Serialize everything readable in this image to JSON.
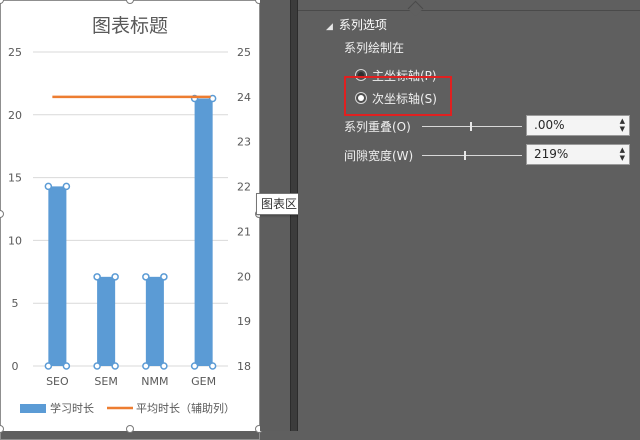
{
  "chart_data": {
    "type": "bar",
    "title": "图表标题",
    "categories": [
      "SEO",
      "SEM",
      "NMM",
      "GEM"
    ],
    "series": [
      {
        "name": "学习时长",
        "kind": "bar",
        "axis": "primary",
        "color": "#5b9bd5",
        "values": [
          14.3,
          7.1,
          7.1,
          21.3
        ]
      },
      {
        "name": "平均时长（辅助列）",
        "kind": "line",
        "axis": "secondary",
        "color": "#ed7d31",
        "values": [
          24,
          24,
          24,
          24
        ]
      }
    ],
    "primary_axis": {
      "min": 0,
      "max": 25,
      "ticks": [
        "0",
        "5",
        "10",
        "15",
        "20",
        "25"
      ]
    },
    "secondary_axis": {
      "min": 18,
      "max": 25,
      "ticks": [
        "18",
        "19",
        "20",
        "21",
        "22",
        "23",
        "24",
        "25"
      ]
    },
    "grid": true,
    "legend": "bottom"
  },
  "tooltip": "图表区",
  "pane": {
    "section_title": "系列选项",
    "plot_on_label": "系列绘制在",
    "primary_axis_option": "主坐标轴(P)",
    "secondary_axis_option": "次坐标轴(S)",
    "selected_option": "secondary",
    "overlap_label": "系列重叠(O)",
    "overlap_value": ".00%",
    "gap_width_label": "间隙宽度(W)",
    "gap_width_value": "219%"
  },
  "colors": {
    "highlight": "#e02020",
    "bar": "#5b9bd5",
    "line": "#ed7d31"
  }
}
